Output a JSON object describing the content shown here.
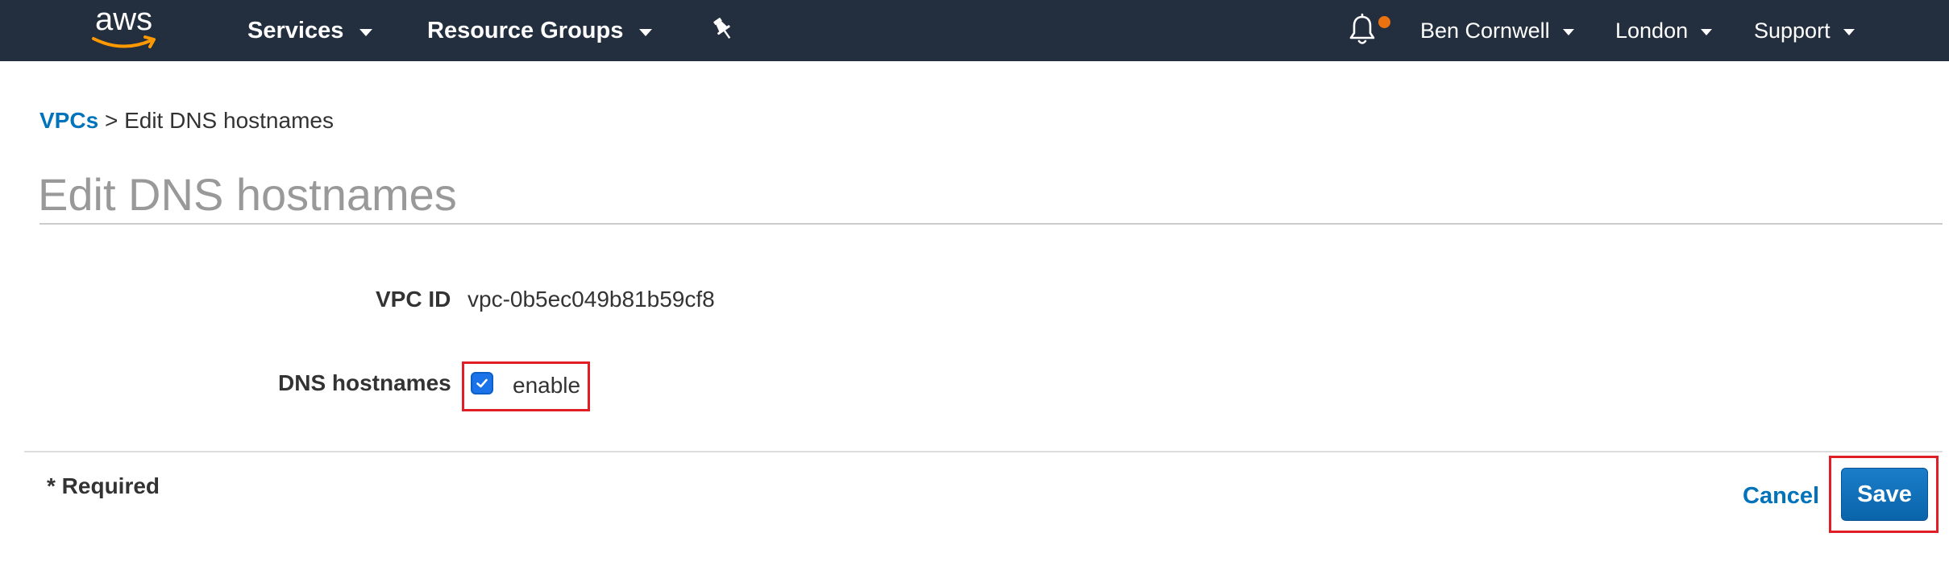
{
  "nav": {
    "logo_text": "aws",
    "services_label": "Services",
    "resource_groups_label": "Resource Groups",
    "pin_icon": "pin-icon",
    "bell_icon": "bell-icon",
    "user_label": "Ben Cornwell",
    "region_label": "London",
    "support_label": "Support"
  },
  "breadcrumb": {
    "parent_label": "VPCs",
    "separator": ">",
    "current_label": "Edit DNS hostnames"
  },
  "page": {
    "title": "Edit DNS hostnames"
  },
  "form": {
    "vpc_id_label": "VPC ID",
    "vpc_id_value": "vpc-0b5ec049b81b59cf8",
    "dns_hostnames_label": "DNS hostnames",
    "dns_hostnames_option": "enable",
    "dns_hostnames_checked": true,
    "required_note": "* Required"
  },
  "actions": {
    "cancel_label": "Cancel",
    "save_label": "Save"
  },
  "colors": {
    "nav_background": "#232f3e",
    "link": "#0073bb",
    "primary_button": "#0a64aa",
    "highlight": "#e01e26",
    "notification_dot": "#ec7211"
  }
}
